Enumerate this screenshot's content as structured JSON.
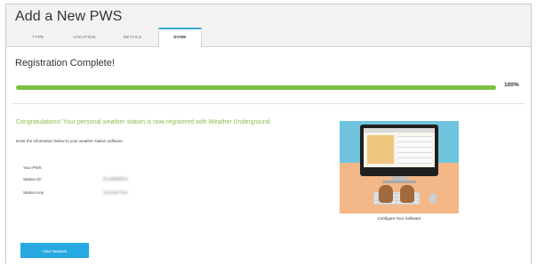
{
  "page": {
    "title": "Add a New PWS"
  },
  "tabs": [
    {
      "label": "TYPE",
      "active": false
    },
    {
      "label": "LOCATION",
      "active": false
    },
    {
      "label": "DETAILS",
      "active": false
    },
    {
      "label": "DONE",
      "active": true
    }
  ],
  "main": {
    "heading": "Registration Complete!",
    "progress": {
      "value_percent": 100,
      "label": "100%"
    },
    "congrats": "Congratulations! Your personal weather station is now registered with Weather Underground.",
    "instructions": "Enter the information below to your weather station software.",
    "info": {
      "section_label": "Your PWS",
      "station_id_label": "Station ID:",
      "station_id_value": "ICLAREM14",
      "station_key_label": "Station Key:",
      "station_key_value": "LicenseTxxx"
    },
    "button_label": "View Network",
    "illustration_caption": "Configure Your Software"
  },
  "colors": {
    "accent": "#26a9e0",
    "progress": "#7cc242",
    "congrats_text": "#8bbd4f",
    "tab_active_border": "#3aa6d8"
  },
  "icons": [
    "computer-illustration-icon"
  ]
}
